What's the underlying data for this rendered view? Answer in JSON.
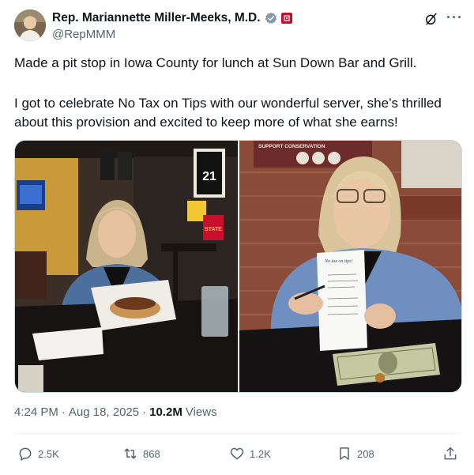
{
  "author": {
    "display_name": "Rep. Mariannette Miller-Meeks, M.D.",
    "handle": "@RepMMM",
    "verified_badge": "gray-verified-icon",
    "affiliation_badge": "house-flag-icon"
  },
  "header_actions": {
    "grok_icon": "grok-icon",
    "more_label": "···"
  },
  "tweet": {
    "paragraph1": "Made a pit stop in Iowa County for lunch at Sun Down Bar and Grill.",
    "paragraph2": "I got to celebrate No Tax on Tips with our wonderful server, she’s thrilled about this provision and excited to keep more of what she earns!"
  },
  "photos": {
    "left": {
      "jersey_number": "21",
      "sign_text": "STATE"
    },
    "right": {
      "banner_text": "SUPPORT CONSERVATION",
      "receipt_title": "No tax on tips!"
    }
  },
  "meta": {
    "time": "4:24 PM",
    "separator": "·",
    "date": "Aug 18, 2025",
    "separator2": "·",
    "views_count": "10.2M",
    "views_label": "Views"
  },
  "actions": {
    "replies": "2.5K",
    "reposts": "868",
    "likes": "1.2K",
    "bookmarks": "208"
  },
  "colors": {
    "text": "#0f1419",
    "secondary": "#536471",
    "divider": "#eff3f4",
    "badge_red": "#c8102e"
  }
}
